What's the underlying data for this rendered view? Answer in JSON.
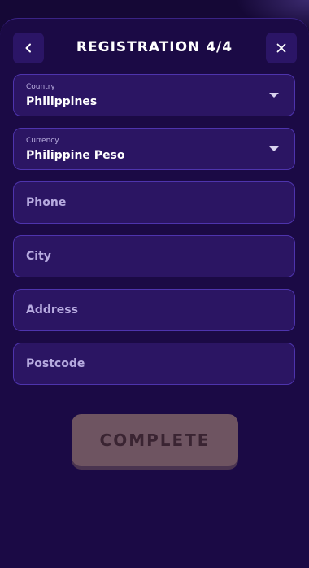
{
  "header": {
    "title": "REGISTRATION 4/4",
    "back_icon": "chevron-left-icon",
    "close_icon": "close-icon"
  },
  "form": {
    "country": {
      "label": "Country",
      "value": "Philippines"
    },
    "currency": {
      "label": "Currency",
      "value": "Philippine Peso"
    },
    "phone": {
      "placeholder": "Phone"
    },
    "city": {
      "placeholder": "City"
    },
    "address": {
      "placeholder": "Address"
    },
    "postcode": {
      "placeholder": "Postcode"
    }
  },
  "actions": {
    "complete_label": "COMPLETE"
  },
  "colors": {
    "background": "#150836",
    "panel": "#1b0a45",
    "field": "#2b1563",
    "field_border": "#4e34ad",
    "button_disabled": "#6e5461"
  }
}
